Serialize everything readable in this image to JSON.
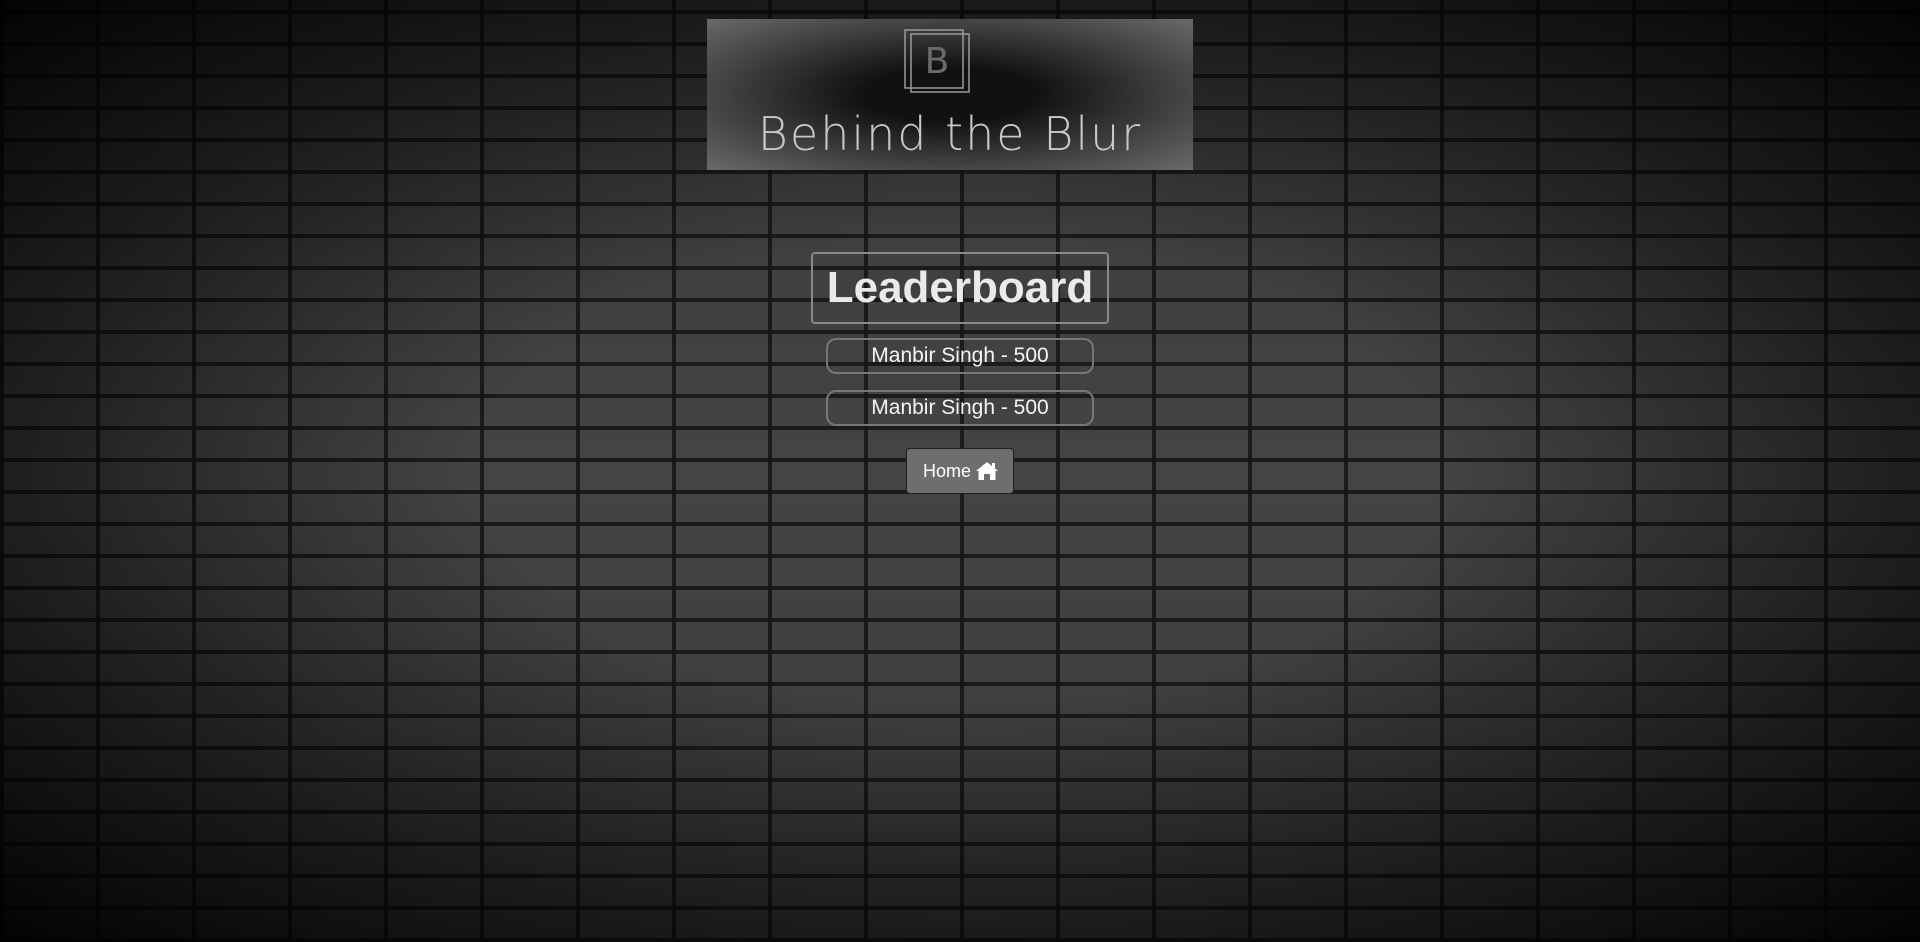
{
  "logo": {
    "letter": "B",
    "text": "Behind the Blur"
  },
  "leaderboard": {
    "title": "Leaderboard",
    "entries": [
      "Manbir Singh - 500",
      "Manbir Singh - 500"
    ]
  },
  "home_button": {
    "label": "Home",
    "icon": "home-icon"
  }
}
